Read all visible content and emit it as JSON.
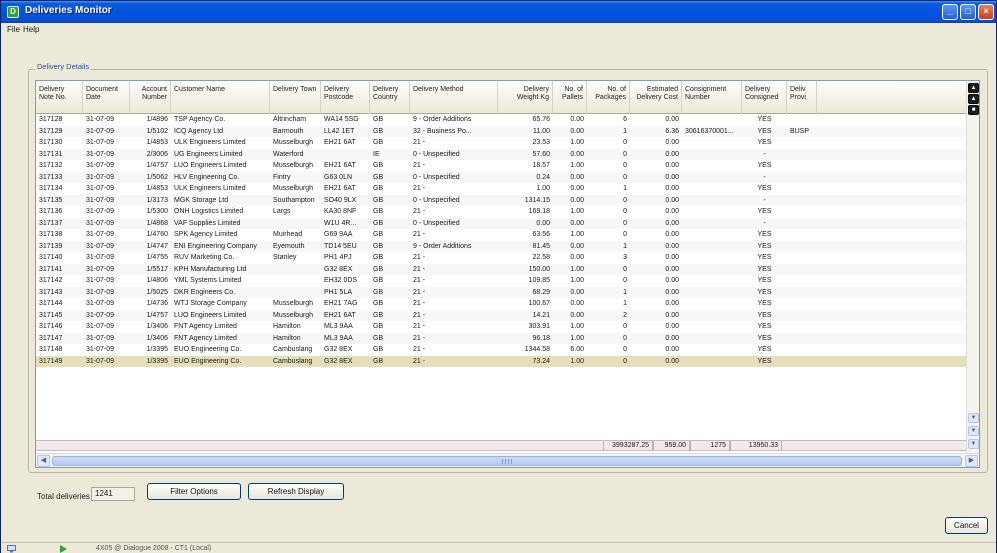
{
  "window": {
    "title": "Deliveries Monitor",
    "app_icon": "app-icon"
  },
  "menu": {
    "file": "File",
    "help": "Help"
  },
  "group_label": "Delivery Details",
  "columns": [
    {
      "label": "Delivery Note No."
    },
    {
      "label": "Document Date"
    },
    {
      "label": "Account Number"
    },
    {
      "label": "Customer Name"
    },
    {
      "label": "Delivery Town"
    },
    {
      "label": "Delivery Postcode"
    },
    {
      "label": "Delivery Country"
    },
    {
      "label": "Delivery Method"
    },
    {
      "label": "Delivery Weight Kg"
    },
    {
      "label": "No. of Pallets"
    },
    {
      "label": "No. of Packages"
    },
    {
      "label": "Estimated Delivery Cost"
    },
    {
      "label": "Consignment Number"
    },
    {
      "label": "Delivery Consigned"
    },
    {
      "label": "Deliv Provi"
    }
  ],
  "rows": [
    [
      "317128",
      "31-07-09",
      "1/4896",
      "TSP Agency Co.",
      "Altrincham",
      "WA14 5SG",
      "GB",
      "9 - Order Additions",
      "65.76",
      "0.00",
      "6",
      "0.00",
      "",
      "YES",
      ""
    ],
    [
      "317129",
      "31-07-09",
      "1/5102",
      "ICQ Agency Ltd",
      "Barmouth",
      "LL42 1ET",
      "GB",
      "32 - Business Po...",
      "11.00",
      "0.00",
      "1",
      "6.36",
      "30616370001...",
      "YES",
      "BUSP"
    ],
    [
      "317130",
      "31-07-09",
      "1/4853",
      "ULK Engineers Limited",
      "Musselburgh",
      "EH21 6AT",
      "GB",
      "21 -",
      "23.53",
      "1.00",
      "0",
      "0.00",
      "",
      "YES",
      ""
    ],
    [
      "317131",
      "31-07-09",
      "2/3006",
      "UG Engineers Limited",
      "Waterford",
      "",
      "IE",
      "0 - Unspecified",
      "57.60",
      "0.00",
      "0",
      "0.00",
      "",
      "-",
      ""
    ],
    [
      "317132",
      "31-07-09",
      "1/4757",
      "LUO Engineers Limited",
      "Musselburgh",
      "EH21 6AT",
      "GB",
      "21 -",
      "18.57",
      "1.00",
      "0",
      "0.00",
      "",
      "YES",
      ""
    ],
    [
      "317133",
      "31-07-09",
      "1/5062",
      "HLV Engineering Co.",
      "Fintry",
      "G63 0LN",
      "GB",
      "0 - Unspecified",
      "0.24",
      "0.00",
      "0",
      "0.00",
      "",
      "-",
      ""
    ],
    [
      "317134",
      "31-07-09",
      "1/4853",
      "ULK Engineers Limited",
      "Musselburgh",
      "EH21 6AT",
      "GB",
      "21 -",
      "1.00",
      "0.00",
      "1",
      "0.00",
      "",
      "YES",
      ""
    ],
    [
      "317135",
      "31-07-09",
      "1/3173",
      "MGK Storage Ltd",
      "Southampton",
      "SO40 9LX",
      "GB",
      "0 - Unspecified",
      "1314.15",
      "0.00",
      "0",
      "0.00",
      "",
      "-",
      ""
    ],
    [
      "317136",
      "31-07-09",
      "1/5300",
      "ONH Logistics Limited",
      "Largs",
      "KA30 8NF",
      "GB",
      "21 -",
      "169.18",
      "1.00",
      "0",
      "0.00",
      "",
      "YES",
      ""
    ],
    [
      "317137",
      "31-07-09",
      "1/4868",
      "VAF Supplies Limited",
      "",
      "W1U 4R...",
      "GB",
      "0 - Unspecified",
      "0.00",
      "0.00",
      "0",
      "0.00",
      "",
      "-",
      ""
    ],
    [
      "317138",
      "31-07-09",
      "1/4760",
      "SPK Agency Limited",
      "Muirhead",
      "G69 9AA",
      "GB",
      "21 -",
      "63.56",
      "1.00",
      "0",
      "0.00",
      "",
      "YES",
      ""
    ],
    [
      "317139",
      "31-07-09",
      "1/4747",
      "ENI Engineering Company",
      "Eyemouth",
      "TD14 5EU",
      "GB",
      "9 - Order Additions",
      "81.45",
      "0.00",
      "1",
      "0.00",
      "",
      "YES",
      ""
    ],
    [
      "317140",
      "31-07-09",
      "1/4755",
      "RUV Marketing Co.",
      "Stanley",
      "PH1 4PJ",
      "GB",
      "21 -",
      "22.58",
      "0.00",
      "3",
      "0.00",
      "",
      "YES",
      ""
    ],
    [
      "317141",
      "31-07-09",
      "1/5517",
      "KPH Manufacturing Ltd",
      "",
      "G32 8EX",
      "GB",
      "21 -",
      "150.00",
      "1.00",
      "0",
      "0.00",
      "",
      "YES",
      ""
    ],
    [
      "317142",
      "31-07-09",
      "1/4806",
      "YML Systems Limited",
      "",
      "EH32 0DS",
      "GB",
      "21 -",
      "109.85",
      "1.00",
      "0",
      "0.00",
      "",
      "YES",
      ""
    ],
    [
      "317143",
      "31-07-09",
      "1/5025",
      "DKR Engineers Co.",
      "",
      "PH1 5LA",
      "GB",
      "21 -",
      "68.29",
      "0.00",
      "1",
      "0.00",
      "",
      "YES",
      ""
    ],
    [
      "317144",
      "31-07-09",
      "1/4736",
      "WTJ Storage Company",
      "Musselburgh",
      "EH21 7AG",
      "GB",
      "21 -",
      "100.67",
      "0.00",
      "1",
      "0.00",
      "",
      "YES",
      ""
    ],
    [
      "317145",
      "31-07-09",
      "1/4757",
      "LUO Engineers Limited",
      "Musselburgh",
      "EH21 6AT",
      "GB",
      "21 -",
      "14.21",
      "0.00",
      "2",
      "0.00",
      "",
      "YES",
      ""
    ],
    [
      "317146",
      "31-07-09",
      "1/3406",
      "FNT Agency Limited",
      "Hamilton",
      "ML3 9AA",
      "GB",
      "21 -",
      "303.91",
      "1.00",
      "0",
      "0.00",
      "",
      "YES",
      ""
    ],
    [
      "317147",
      "31-07-09",
      "1/3406",
      "FNT Agency Limited",
      "Hamilton",
      "ML3 9AA",
      "GB",
      "21 -",
      "96.18",
      "1.00",
      "0",
      "0.00",
      "",
      "YES",
      ""
    ],
    [
      "317148",
      "31-07-09",
      "1/3395",
      "EUO Engineering Co.",
      "Cambuslang",
      "G32 8EX",
      "GB",
      "21 -",
      "1344.58",
      "6.00",
      "0",
      "0.00",
      "",
      "YES",
      ""
    ],
    [
      "317149",
      "31-07-09",
      "1/3395",
      "EUO Engineering Co.",
      "Cambuslang",
      "G32 8EX",
      "GB",
      "21 -",
      "73.24",
      "1.00",
      "0",
      "0.00",
      "",
      "YES",
      ""
    ]
  ],
  "selected_row": 21,
  "totals": {
    "weight": "3993287.25",
    "pallets": "959.00",
    "packages": "1275",
    "cost": "13950.33"
  },
  "total_deliveries_label": "Total deliveries",
  "total_deliveries_value": "1241",
  "buttons": {
    "filter": "Filter Options",
    "refresh": "Refresh Display",
    "cancel": "Cancel"
  },
  "status": {
    "text": "4X05 @ Dialogue 2008 - CT1 (Local)"
  },
  "colors": {
    "title_bar": "#0054e3",
    "selected_row": "#e4dfb9",
    "totals_row": "#f2e8ee",
    "group_label": "#2a4fa0"
  }
}
